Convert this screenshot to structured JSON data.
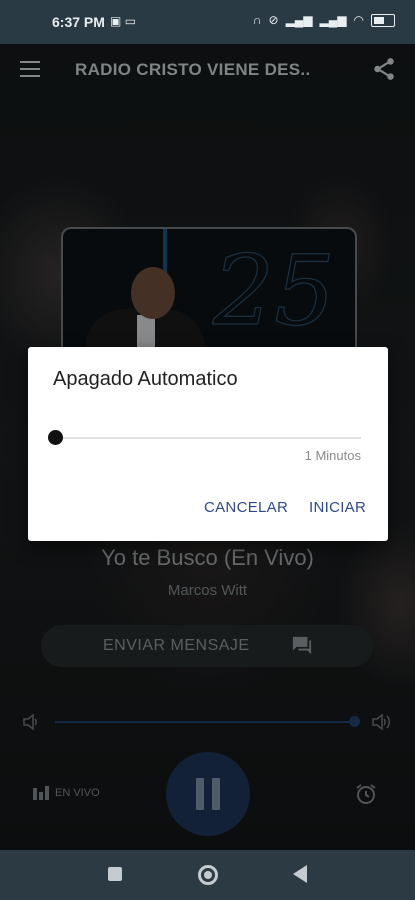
{
  "status_bar": {
    "time": "6:37 PM",
    "left_icons": [
      "message-icon",
      "laptop-icon"
    ],
    "right_icons": [
      "headphones-icon",
      "do-not-disturb-icon",
      "signal-icon",
      "signal-icon",
      "wifi-icon",
      "battery-icon"
    ]
  },
  "app_bar": {
    "title": "RADIO CRISTO VIENE DES..",
    "menu_icon": "hamburger-icon",
    "share_icon": "share-icon"
  },
  "now_playing": {
    "title": "Yo te Busco (En Vivo)",
    "artist": "Marcos Witt",
    "art_text": "25"
  },
  "send_message": {
    "label": "ENVIAR MENSAJE",
    "icon": "chat-icon"
  },
  "volume": {
    "level": 0.98
  },
  "controls": {
    "live_label": "EN VIVO",
    "play_state": "pause",
    "alarm_icon": "alarm-icon"
  },
  "dialog": {
    "title": "Apagado Automatico",
    "slider_value": 0,
    "value_label": "1 Minutos",
    "cancel_label": "CANCELAR",
    "start_label": "INICIAR"
  },
  "colors": {
    "accent": "#1c3357",
    "dialog_button": "#2f4a8a",
    "status_bar": "#2a3a44",
    "nav_bar": "#2c3a43"
  }
}
